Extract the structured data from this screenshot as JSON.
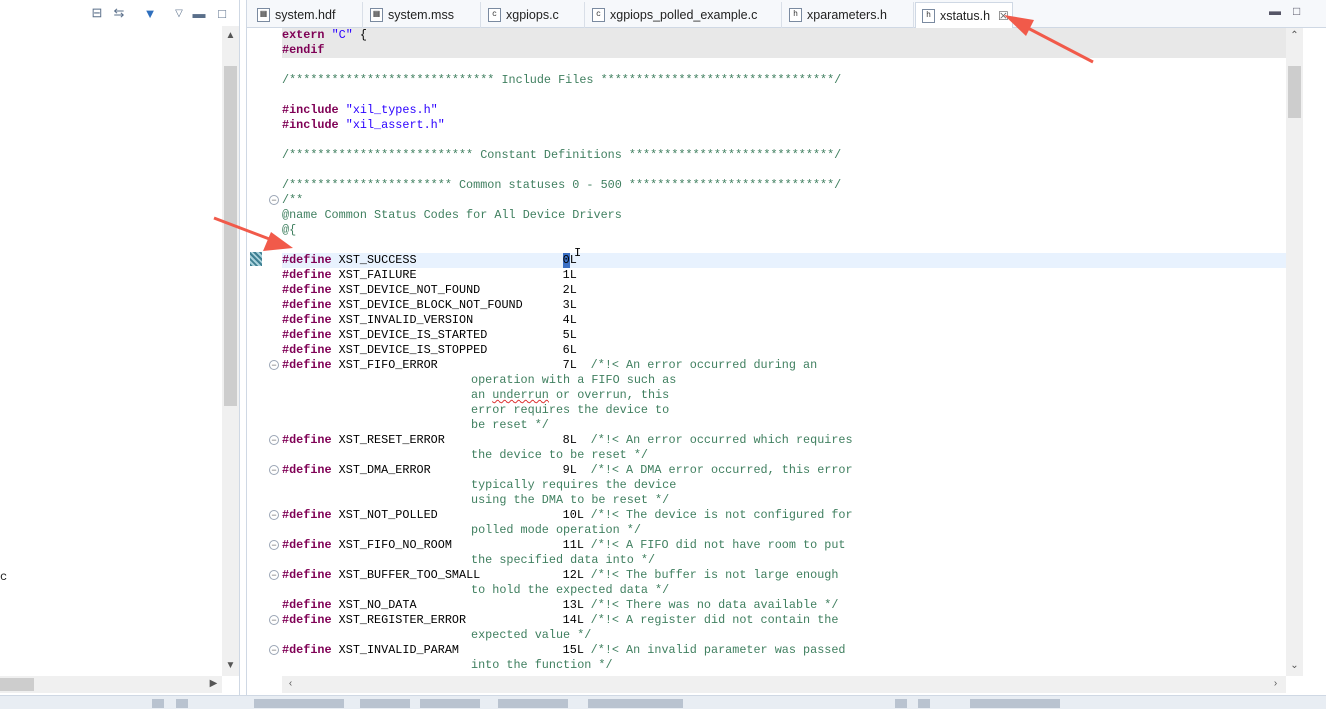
{
  "left_pane": {
    "toolbar_icons": [
      "collapse-all-icon",
      "link-editor-icon",
      "filter-icon",
      "view-menu-icon",
      "minimize-icon",
      "maximize-icon"
    ],
    "truncated_text": "c"
  },
  "editor": {
    "tabs": [
      {
        "label": "system.hdf",
        "icon": "hdf-file-icon",
        "glyph": "▦"
      },
      {
        "label": "system.mss",
        "icon": "mss-file-icon",
        "glyph": "▦"
      },
      {
        "label": "xgpiops.c",
        "icon": "c-file-icon",
        "glyph": "c"
      },
      {
        "label": "xgpiops_polled_example.c",
        "icon": "c-file-icon",
        "glyph": "c"
      },
      {
        "label": "xparameters.h",
        "icon": "h-file-icon",
        "glyph": "h"
      },
      {
        "label": "xstatus.h",
        "icon": "h-file-icon",
        "glyph": "h",
        "active": true
      }
    ],
    "accent_color": "#f15a4a"
  },
  "code": {
    "line1_kw": "extern",
    "line1_str": "\"C\"",
    "line1_rest": " {",
    "line2_kw": "#endif",
    "include_banner": "/***************************** Include Files *********************************/",
    "inc1_kw": "#include",
    "inc1_str": "\"xil_types.h\"",
    "inc2_kw": "#include",
    "inc2_str": "\"xil_assert.h\"",
    "const_banner": "/************************** Constant Definitions *****************************/",
    "common_banner": "/*********************** Common statuses 0 - 500 *****************************/",
    "doc_open": "/**",
    "doc_name": "@name Common Status Codes for All Device Drivers",
    "doc_brace": "@{",
    "defines": [
      {
        "name": "XST_SUCCESS",
        "value": "0L"
      },
      {
        "name": "XST_FAILURE",
        "value": "1L"
      },
      {
        "name": "XST_DEVICE_NOT_FOUND",
        "value": "2L"
      },
      {
        "name": "XST_DEVICE_BLOCK_NOT_FOUND",
        "value": "3L"
      },
      {
        "name": "XST_INVALID_VERSION",
        "value": "4L"
      },
      {
        "name": "XST_DEVICE_IS_STARTED",
        "value": "5L"
      },
      {
        "name": "XST_DEVICE_IS_STOPPED",
        "value": "6L"
      },
      {
        "name": "XST_FIFO_ERROR",
        "value": "7L",
        "comment": "/*!< An error occurred during an",
        "cont": [
          "operation with a FIFO such as",
          "an underrun or overrun, this",
          "error requires the device to",
          "be reset */"
        ]
      },
      {
        "name": "XST_RESET_ERROR",
        "value": "8L",
        "comment": "/*!< An error occurred which requires",
        "cont": [
          "the device to be reset */"
        ]
      },
      {
        "name": "XST_DMA_ERROR",
        "value": "9L",
        "comment": "/*!< A DMA error occurred, this error",
        "cont": [
          "typically requires the device",
          "using the DMA to be reset */"
        ]
      },
      {
        "name": "XST_NOT_POLLED",
        "value": "10L",
        "comment": "/*!< The device is not configured for",
        "cont": [
          "polled mode operation */"
        ]
      },
      {
        "name": "XST_FIFO_NO_ROOM",
        "value": "11L",
        "comment": "/*!< A FIFO did not have room to put",
        "cont": [
          "the specified data into */"
        ]
      },
      {
        "name": "XST_BUFFER_TOO_SMALL",
        "value": "12L",
        "comment": "/*!< The buffer is not large enough",
        "cont": [
          "to hold the expected data */"
        ]
      },
      {
        "name": "XST_NO_DATA",
        "value": "13L",
        "comment": "/*!< There was no data available */",
        "cont": []
      },
      {
        "name": "XST_REGISTER_ERROR",
        "value": "14L",
        "comment": "/*!< A register did not contain the",
        "cont": [
          "expected value */"
        ]
      },
      {
        "name": "XST_INVALID_PARAM",
        "value": "15L",
        "comment": "/*!< An invalid parameter was passed",
        "cont": [
          "into the function */"
        ]
      }
    ]
  }
}
